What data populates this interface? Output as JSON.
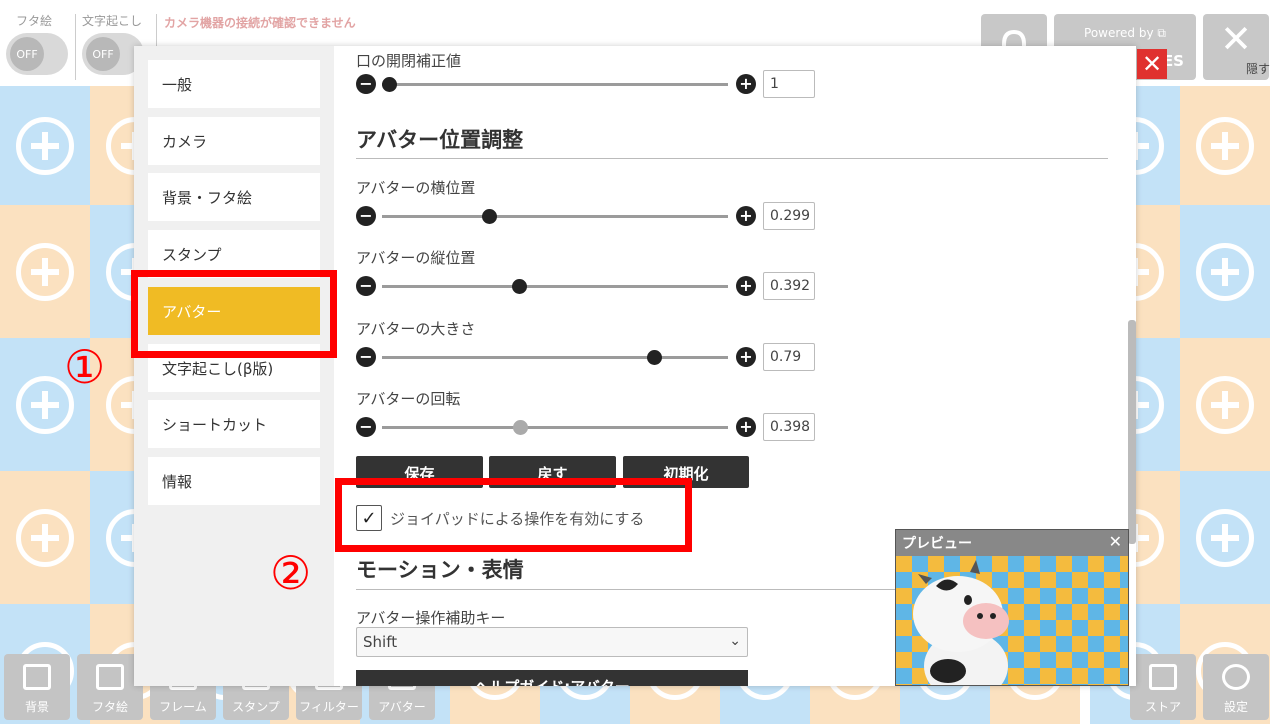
{
  "topbar": {
    "lid_toggle": {
      "label": "フタ絵",
      "state": "OFF"
    },
    "transcription_toggle": {
      "label": "文字起こし",
      "state": "OFF"
    },
    "camera_warning": "カメラ機器の接続が確認できません",
    "powered_by": "Powered by",
    "powered_suffix": "ES",
    "hide_label": "隠す"
  },
  "bottombar": {
    "buttons": [
      {
        "label": "背景",
        "icon": "background-icon"
      },
      {
        "label": "フタ絵",
        "icon": "lid-art-icon"
      },
      {
        "label": "フレーム",
        "icon": "frame-icon"
      },
      {
        "label": "スタンプ",
        "icon": "stamp-icon"
      },
      {
        "label": "フィルター",
        "icon": "filter-icon"
      },
      {
        "label": "アバター",
        "icon": "avatar-icon"
      },
      {
        "label": "ストア",
        "icon": "store-icon"
      },
      {
        "label": "設定",
        "icon": "gear-icon"
      }
    ]
  },
  "sidebar": {
    "items": [
      {
        "label": "一般"
      },
      {
        "label": "カメラ"
      },
      {
        "label": "背景・フタ絵"
      },
      {
        "label": "スタンプ"
      },
      {
        "label": "アバター",
        "active": true
      },
      {
        "label": "文字起こし(β版)"
      },
      {
        "label": "ショートカット"
      },
      {
        "label": "情報"
      }
    ]
  },
  "settings": {
    "mouth_correction": {
      "label": "口の開閉補正値",
      "value": "1",
      "fraction": 0.02
    },
    "position_section_title": "アバター位置調整",
    "sliders": [
      {
        "label": "アバターの横位置",
        "value": "0.299",
        "fraction": 0.31,
        "dim": false
      },
      {
        "label": "アバターの縦位置",
        "value": "0.392",
        "fraction": 0.395,
        "dim": false
      },
      {
        "label": "アバターの大きさ",
        "value": "0.79",
        "fraction": 0.785,
        "dim": false
      },
      {
        "label": "アバターの回転",
        "value": "0.398",
        "fraction": 0.4,
        "dim": true
      }
    ],
    "buttons": {
      "save": "保存",
      "revert": "戻す",
      "reset": "初期化"
    },
    "joypad": {
      "label": "ジョイパッドによる操作を有効にする",
      "checked": true
    },
    "motion_section_title": "モーション・表情",
    "helper_key": {
      "label": "アバター操作補助キー",
      "value": "Shift"
    },
    "help_guide_button": "ヘルプガイド:アバター"
  },
  "annotations": {
    "one": "①",
    "two": "②",
    "color": "#ff0000"
  },
  "preview": {
    "title": "プレビュー"
  },
  "colors": {
    "accent": "#f0bb24",
    "close_red": "#e0312f",
    "tile_blue": "#c3e2f7",
    "tile_peach": "#fbe1c0"
  }
}
